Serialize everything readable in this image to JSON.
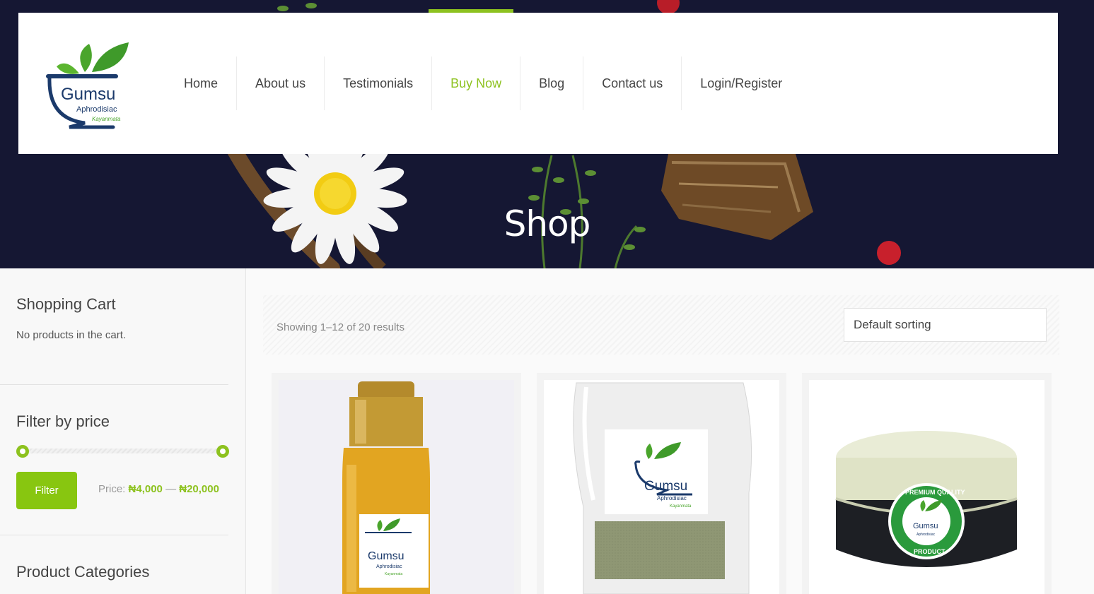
{
  "brand": {
    "name": "Gumsu",
    "tagline": "Aphrodisiac",
    "sub": "Kayanmata",
    "colors": {
      "accent": "#8dc21f",
      "navy": "#1b3a6b",
      "hero": "#151733"
    }
  },
  "nav": {
    "items": [
      {
        "label": "Home"
      },
      {
        "label": "About us"
      },
      {
        "label": "Testimonials"
      },
      {
        "label": "Buy Now",
        "active": true
      },
      {
        "label": "Blog"
      },
      {
        "label": "Contact us"
      },
      {
        "label": "Login/Register"
      }
    ]
  },
  "hero": {
    "title": "Shop"
  },
  "sidebar": {
    "cart": {
      "title": "Shopping Cart",
      "empty_text": "No products in the cart."
    },
    "price_filter": {
      "title": "Filter by price",
      "button_label": "Filter",
      "price_prefix": "Price:",
      "min": "₦4,000",
      "separator": "—",
      "max": "₦20,000"
    },
    "categories": {
      "title": "Product Categories"
    }
  },
  "shop": {
    "result_count": "Showing 1–12 of 20 results",
    "sort": {
      "selected": "Default sorting"
    }
  },
  "products": [
    {
      "type": "oil-bottle",
      "label_brand": "Gumsu",
      "label_tagline": "Aphrodisiac",
      "label_sub": "Kayanmata"
    },
    {
      "type": "powder-pouch",
      "label_brand": "Gumsu",
      "label_tagline": "Aphrodisiac",
      "label_sub": "Kayanmata"
    },
    {
      "type": "cream-jar",
      "label_brand": "Gumsu",
      "label_tagline": "Aphrodisiac",
      "badge_top": "PREMIUM QUALITY",
      "badge_bottom": "PRODUCT"
    }
  ]
}
